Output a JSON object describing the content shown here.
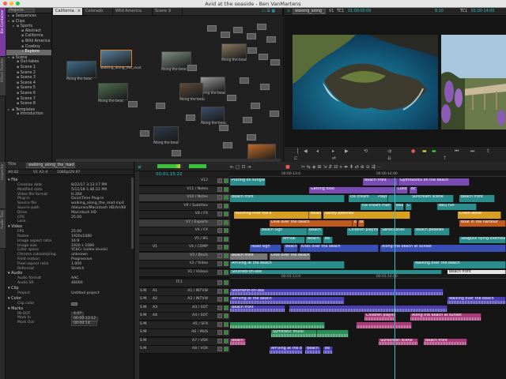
{
  "window": {
    "title": "Avid at the seaside - Ben VanMartens"
  },
  "colors": {
    "accent_purple": "#7c3aa5",
    "timecode": "#2ec4c4",
    "selection": "#d9822b"
  },
  "left_tabs": [
    "Bin Container",
    "Effect Palette",
    "Inspector",
    "Audio Tool",
    "Timeline"
  ],
  "project": {
    "header": "Projects",
    "tree": [
      {
        "label": "Sequences",
        "indent": 0,
        "tri": "▸"
      },
      {
        "label": "Clips",
        "indent": 0,
        "tri": "▾"
      },
      {
        "label": "Sports",
        "indent": 1,
        "tri": "▸"
      },
      {
        "label": "Abstract",
        "indent": 2,
        "tri": ""
      },
      {
        "label": "California",
        "indent": 2,
        "tri": ""
      },
      {
        "label": "Wild America",
        "indent": 2,
        "tri": ""
      },
      {
        "label": "Cowboy",
        "indent": 2,
        "tri": ""
      },
      {
        "label": "Explore",
        "indent": 2,
        "tri": "",
        "sel": true
      },
      {
        "label": "Scene",
        "indent": 0,
        "tri": "▾"
      },
      {
        "label": "Out-takes",
        "indent": 1,
        "tri": ""
      },
      {
        "label": "Scene 1",
        "indent": 1,
        "tri": ""
      },
      {
        "label": "Scene 2",
        "indent": 1,
        "tri": ""
      },
      {
        "label": "Scene 3",
        "indent": 1,
        "tri": ""
      },
      {
        "label": "Scene 4",
        "indent": 1,
        "tri": ""
      },
      {
        "label": "Scene 5",
        "indent": 1,
        "tri": ""
      },
      {
        "label": "Scene 6",
        "indent": 1,
        "tri": ""
      },
      {
        "label": "Scene 7",
        "indent": 1,
        "tri": ""
      },
      {
        "label": "Scene 8",
        "indent": 1,
        "tri": ""
      },
      {
        "label": "Templates",
        "indent": 0,
        "tri": "▸"
      },
      {
        "label": "Introduction",
        "indent": 1,
        "tri": ""
      }
    ]
  },
  "bin": {
    "tabs": [
      {
        "label": "California",
        "active": true
      },
      {
        "label": "Colorado"
      },
      {
        "label": "Wild America"
      },
      {
        "label": "Scene 9"
      }
    ],
    "thumbs": [
      {
        "cap": "Along the beac",
        "color": "#3f6c8a"
      },
      {
        "cap": "walking_along_the_road",
        "color": "#5a7f9c",
        "sel": true
      },
      {
        "cap": "Along the beac",
        "color": "#7e8f84"
      },
      {
        "cap": "Along the beac",
        "color": "#8a7a60"
      },
      {
        "cap": "Along the beac",
        "color": "#9a9a9a"
      },
      {
        "cap": "Along the beac",
        "color": "#4e6e4e"
      },
      {
        "cap": "Along the beac",
        "color": "#5f4a3a"
      },
      {
        "cap": "Along the beac",
        "color": "#3a4f6a"
      },
      {
        "cap": "Along the beac",
        "color": "#2e3a4a"
      },
      {
        "cap": "Along the beac",
        "color": "#c06a2a"
      }
    ]
  },
  "source": {
    "clip": "walking_along_",
    "v1": "V1",
    "tc1": "TC1",
    "tc": "01:00:00:00",
    "dur": "8:10"
  },
  "record": {
    "track": "TC1",
    "tc": "01:00:14:00"
  },
  "inspector": {
    "title": "Title",
    "clipname": "walking_along_the_road",
    "sub": [
      "A0:02",
      "V1 A1-4",
      "1080p/29.97"
    ],
    "sections": [
      {
        "name": "File",
        "rows": [
          [
            "Creation date",
            "8/22/17   3:13:17 PM"
          ],
          [
            "Modified date",
            "5/11/18   1:46:22 PM"
          ],
          [
            "Video file format",
            "H.264"
          ],
          [
            "Plug-in",
            "QuickTime Plug-in"
          ],
          [
            "Source file",
            "walking_along_the_road.mp4"
          ],
          [
            "Source path",
            "/Volumes/Macintosh HD/Ari/Kil"
          ],
          [
            "Drive",
            "Macintosh HD"
          ],
          [
            "CPS",
            "25.00"
          ],
          [
            "Lock",
            ""
          ]
        ]
      },
      {
        "name": "Video",
        "rows": [
          [
            "FPS",
            "25.00"
          ],
          [
            "Raster",
            "1920x1080"
          ],
          [
            "Image aspect ratio",
            "16:9"
          ],
          [
            "Image size",
            "1920 x 1080"
          ],
          [
            "Color space",
            "YCbCr (video levels)"
          ],
          [
            "Chroma subsampling",
            "unknown"
          ],
          [
            "Field motion",
            "Progressive"
          ],
          [
            "Pixel aspect ratio",
            "1.000"
          ],
          [
            "Reformat",
            "Stretch"
          ]
        ]
      },
      {
        "name": "Audio",
        "rows": [
          [
            "Audio format",
            "AAC"
          ],
          [
            "Audio SR",
            "48000"
          ]
        ]
      },
      {
        "name": "Clip",
        "rows": [
          [
            "Project",
            "Untitled project"
          ]
        ]
      },
      {
        "name": "Color",
        "rows": [
          [
            "Clip color",
            ""
          ]
        ]
      },
      {
        "name": "Marks",
        "rows": [
          [
            "IN-OUT",
            "4:07"
          ],
          [
            "Mark In",
            "00:00:13:12"
          ],
          [
            "Mark Out",
            "00:00:14:..."
          ]
        ]
      }
    ]
  },
  "timeline": {
    "tc": "00:01:15:22",
    "ruler": [
      "00:00:13:0",
      "00:00:14:00",
      "00:01:13:0",
      "00:01:14:00"
    ],
    "tracks": [
      {
        "name": "V12",
        "clips": [
          [
            "Putting on sunglas",
            0,
            45,
            "#2b8c8c"
          ],
          [
            "Beach front",
            168,
            45,
            "#7b4bb5"
          ],
          [
            "Gymnastics on the beach",
            213,
            90,
            "#7b4bb5"
          ]
        ]
      },
      {
        "name": "V11 / Notes",
        "clips": [
          [
            "Getting food",
            100,
            110,
            "#7b4bb5"
          ],
          [
            "Lunch",
            210,
            15,
            "#7b4bb5"
          ],
          [
            "Bc",
            227,
            10,
            "#7b4bb5"
          ]
        ]
      },
      {
        "name": "V10 / Notes",
        "patch": true,
        "clips": [
          [
            "Beach front",
            0,
            145,
            "#2b8c8c"
          ],
          [
            "Ice cream",
            150,
            80,
            "#2b8c8c"
          ],
          [
            "Playing",
            185,
            15,
            "#2b8c8c"
          ],
          [
            "Suncream scene",
            228,
            55,
            "#2b8c8c"
          ],
          [
            "Beach front",
            290,
            45,
            "#2b8c8c"
          ]
        ]
      },
      {
        "name": "V9 / Subtitles",
        "clips": [
          [
            "Ice cream man",
            165,
            40,
            "#2b8c8c"
          ],
          [
            "Beach",
            208,
            12,
            "#2b8c8c"
          ],
          [
            "C",
            222,
            8,
            "#2b8c8c"
          ],
          [
            "BBQ fun",
            262,
            50,
            "#2b8c8c"
          ]
        ]
      },
      {
        "name": "V8 / FX",
        "clips": [
          [
            "Running over the s",
            5,
            95,
            "#d8a020"
          ],
          [
            "Beach",
            100,
            16,
            "#d8a020"
          ],
          [
            "Sandy beaches",
            118,
            110,
            "#d8a020"
          ],
          [
            "Crash wave",
            288,
            55,
            "#d8a020"
          ]
        ]
      },
      {
        "name": "V7 / Experts",
        "patch": true,
        "clips": [
          [
            "Dive over the beach",
            50,
            105,
            "#c05a1a"
          ],
          [
            "B",
            155,
            6,
            "#c05a1a"
          ],
          [
            "Bc",
            162,
            8,
            "#c05a1a"
          ],
          [
            "Boat in the harbour",
            290,
            59,
            "#c05a1a"
          ]
        ]
      },
      {
        "name": "V6 / FX",
        "clips": [
          [
            "Beach sign",
            38,
            60,
            "#2b8c8c"
          ],
          [
            "Beach",
            98,
            20,
            "#2b8c8c"
          ],
          [
            "Children playing",
            148,
            40,
            "#2b8c8c"
          ],
          [
            "Sandcastles",
            190,
            40,
            "#2b8c8c"
          ],
          [
            "Beach pebbles",
            233,
            45,
            "#2b8c8c"
          ]
        ]
      },
      {
        "name": "V5 / BG",
        "clips": [
          [
            "Arrival",
            65,
            30,
            "#2b8c8c"
          ],
          [
            "Beach",
            96,
            20,
            "#2b8c8c"
          ],
          [
            "Be",
            118,
            12,
            "#2b8c8c"
          ],
          [
            "Seagulls flying overhead",
            290,
            59,
            "#2b8c8c"
          ]
        ]
      },
      {
        "name": "V4 / COMP",
        "src": "V1",
        "clips": [
          [
            "Road sign",
            25,
            40,
            "#3a4fb5"
          ],
          [
            "Beach",
            68,
            18,
            "#3a4fb5"
          ],
          [
            "Kites over the beach",
            88,
            100,
            "#3a4fb5"
          ],
          [
            "Along the beach at sunset",
            190,
            159,
            "#3a4fb5"
          ]
        ]
      },
      {
        "name": "V3 / Black",
        "patch": true,
        "clips": [
          [
            "Beach front",
            0,
            48,
            "#777777"
          ],
          [
            "Dive over the beach",
            50,
            52,
            "#777777"
          ]
        ]
      },
      {
        "name": "V2 / Video",
        "clips": [
          [
            "Arriving at the beach",
            0,
            145,
            "#2b8c8c"
          ],
          [
            "Walking over the beach",
            232,
            117,
            "#2b8c8c"
          ]
        ]
      },
      {
        "name": "V1 / Videos",
        "clips": [
          [
            "Southed-on-sea",
            0,
            268,
            "#2b8c8c"
          ],
          [
            "Beach front",
            275,
            74,
            "#e6e6e6"
          ]
        ]
      },
      {
        "name": "TC1",
        "clips": []
      },
      {
        "name": "A1 / INTVW",
        "src": "A1",
        "audio": true,
        "clips": [
          [
            "Southend-on-sea",
            0,
            270,
            "#4a3fb0"
          ]
        ]
      },
      {
        "name": "A2 / INTVW",
        "src": "A2",
        "audio": true,
        "clips": [
          [
            "Arriving at the beach",
            0,
            145,
            "#4a3fb0"
          ],
          [
            "Walking over the beach",
            275,
            74,
            "#4a3fb0"
          ]
        ]
      },
      {
        "name": "A3 / SOT",
        "src": "A3",
        "audio": true,
        "clips": [
          [
            "Beach front",
            0,
            70,
            "#4a3fb0"
          ],
          [
            "",
            75,
            200,
            "#4a3fb0"
          ]
        ]
      },
      {
        "name": "A4 / SOT",
        "src": "A4",
        "audio": true,
        "clips": [
          [
            "Children playing",
            170,
            40,
            "#a83a7a"
          ],
          [
            "Along the beach at sunset",
            228,
            90,
            "#a83a7a"
          ]
        ]
      },
      {
        "name": "A5 / SFX",
        "audio": true,
        "clips": [
          [
            "",
            0,
            120,
            "#2b8c5a"
          ],
          [
            "",
            160,
            70,
            "#a83a7a"
          ]
        ]
      },
      {
        "name": "A6 / MUS",
        "audio": true,
        "clips": [
          [
            "Symmetic music",
            52,
            58,
            "#2b8c5a"
          ],
          [
            "",
            110,
            40,
            "#2b8c5a"
          ]
        ]
      },
      {
        "name": "A7 / VOX",
        "audio": true,
        "clips": [
          [
            "Beach",
            0,
            20,
            "#a83a7a"
          ],
          [
            "Sunscreen scene",
            188,
            50,
            "#a83a7a"
          ],
          [
            "Beach front",
            245,
            55,
            "#a83a7a"
          ]
        ]
      },
      {
        "name": "A8 / VOX",
        "audio": true,
        "clips": [
          [
            "Arriving at the beach",
            50,
            42,
            "#4a3fb0"
          ],
          [
            "Beach",
            95,
            20,
            "#4a3fb0"
          ],
          [
            "Be",
            118,
            12,
            "#4a3fb0"
          ]
        ]
      }
    ]
  }
}
